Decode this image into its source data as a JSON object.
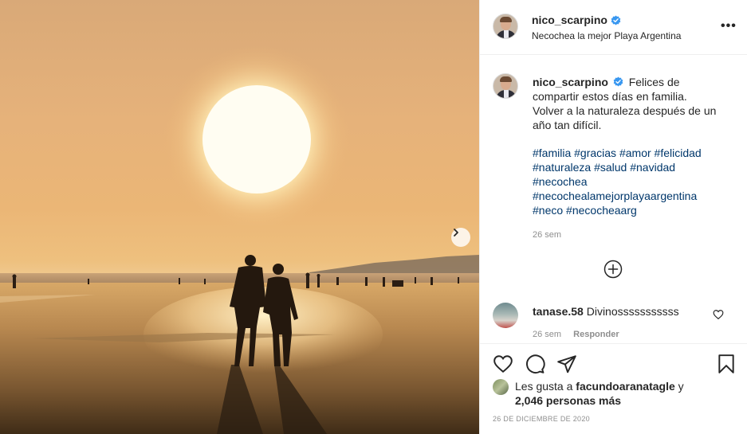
{
  "post": {
    "username": "nico_scarpino",
    "location": "Necochea la mejor Playa Argentina",
    "more_icon": "more-horizontal-icon"
  },
  "caption": {
    "username": "nico_scarpino",
    "text_line1": "Felices de compartir estos días en familia.",
    "text_line2": "Volver a la naturaleza después de un año tan difícil.",
    "hashtags": [
      "#familia",
      "#gracias",
      "#amor",
      "#felicidad",
      "#naturaleza",
      "#salud",
      "#navidad",
      "#necochea",
      "#necochealamejorplayaargentina",
      "#neco",
      "#necocheaarg"
    ],
    "age": "26 sem"
  },
  "comment": {
    "username": "tanase.58",
    "text": "Divinosssssssssss",
    "age": "26 sem",
    "reply_label": "Responder"
  },
  "likes": {
    "prefix": "Les gusta a",
    "user": "facundoaranatagle",
    "joiner": "y",
    "others": "2,046 personas más"
  },
  "date": "26 DE DICIEMBRE DE 2020",
  "colors": {
    "hashtag": "#00376b",
    "verified": "#3897f0",
    "muted": "#8e8e8e",
    "text": "#262626"
  },
  "icons": [
    "heart-icon",
    "comment-icon",
    "share-icon",
    "bookmark-icon",
    "plus-circle-icon",
    "chevron-right-icon",
    "verified-badge-icon"
  ]
}
